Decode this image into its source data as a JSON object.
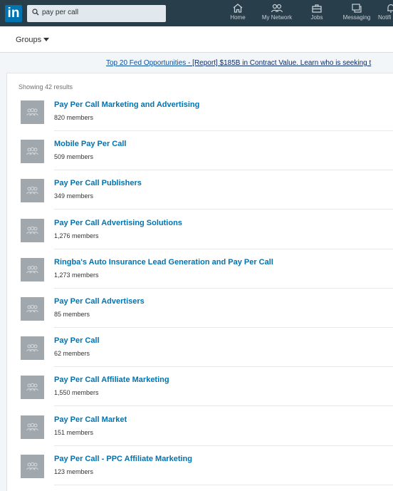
{
  "topbar": {
    "logo": "in",
    "search_value": "pay per call",
    "nav": [
      {
        "label": "Home",
        "icon": "home-icon"
      },
      {
        "label": "My Network",
        "icon": "network-icon"
      },
      {
        "label": "Jobs",
        "icon": "briefcase-icon"
      },
      {
        "label": "Messaging",
        "icon": "messaging-icon"
      },
      {
        "label": "Notifi",
        "icon": "bell-icon"
      }
    ]
  },
  "subbar": {
    "filter_label": "Groups"
  },
  "ad": {
    "link_text": "Top 20 Fed Opportunities",
    "rest_text": " - [Report] $185B in Contract Value. Learn who is seeking t"
  },
  "results": {
    "showing": "Showing 42 results",
    "items": [
      {
        "name": "Pay Per Call Marketing and Advertising",
        "members": "820 members"
      },
      {
        "name": "Mobile Pay Per Call",
        "members": "509 members"
      },
      {
        "name": "Pay Per Call Publishers",
        "members": "349 members"
      },
      {
        "name": "Pay Per Call Advertising Solutions",
        "members": "1,276 members"
      },
      {
        "name": "Ringba's Auto Insurance Lead Generation and Pay Per Call",
        "members": "1,273 members"
      },
      {
        "name": "Pay Per Call Advertisers",
        "members": "85 members"
      },
      {
        "name": "Pay Per Call",
        "members": "62 members"
      },
      {
        "name": "Pay Per Call Affiliate Marketing",
        "members": "1,550 members"
      },
      {
        "name": "Pay Per Call Market",
        "members": "151 members"
      },
      {
        "name": "Pay Per Call - PPC Affiliate Marketing",
        "members": "123 members"
      }
    ]
  },
  "colors": {
    "nav_bg": "#283e4a",
    "brand_blue": "#0073b1",
    "avatar_gray": "#a0a7ad"
  }
}
